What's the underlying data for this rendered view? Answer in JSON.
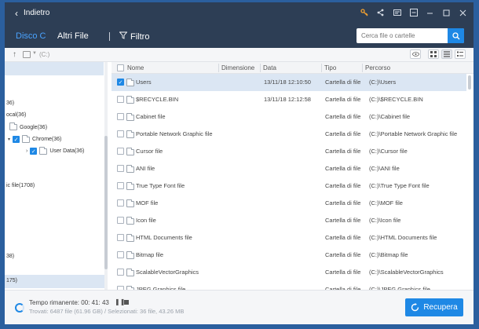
{
  "titlebar": {
    "back_label": "Indietro"
  },
  "nav": {
    "tabs": [
      {
        "label": "Disco C",
        "active": true
      },
      {
        "label": "Altri File",
        "active": false
      }
    ],
    "filter_label": "Filtro",
    "search_placeholder": "Cerca file o cartelle"
  },
  "pathbar": {
    "path": "(C:)"
  },
  "tree": {
    "items": [
      {
        "label": "36)"
      },
      {
        "label": "ocal(36)"
      },
      {
        "label": "Google(36)"
      },
      {
        "label": "Chrome(36)"
      },
      {
        "label": "User Data(36)"
      },
      {
        "label": "ic file(1708)"
      },
      {
        "label": "38)"
      },
      {
        "label": "175)"
      }
    ]
  },
  "list": {
    "columns": [
      "Nome",
      "Dimensione",
      "Data",
      "Tipo",
      "Percorso"
    ],
    "rows": [
      {
        "name": "Users",
        "date": "13/11/18 12:10:50",
        "type": "Cartella di file",
        "path": "(C:)\\Users"
      },
      {
        "name": "$RECYCLE.BIN",
        "date": "13/11/18 12:12:58",
        "type": "Cartella di file",
        "path": "(C:)\\$RECYCLE.BIN"
      },
      {
        "name": "Cabinet file",
        "date": "",
        "type": "Cartella di file",
        "path": "(C:)\\Cabinet file"
      },
      {
        "name": "Portable Network Graphic file",
        "date": "",
        "type": "Cartella di file",
        "path": "(C:)\\Portable Network Graphic file"
      },
      {
        "name": "Cursor file",
        "date": "",
        "type": "Cartella di file",
        "path": "(C:)\\Cursor file"
      },
      {
        "name": "ANI file",
        "date": "",
        "type": "Cartella di file",
        "path": "(C:)\\ANI file"
      },
      {
        "name": "True Type Font file",
        "date": "",
        "type": "Cartella di file",
        "path": "(C:)\\True Type Font file"
      },
      {
        "name": "MOF file",
        "date": "",
        "type": "Cartella di file",
        "path": "(C:)\\MOF file"
      },
      {
        "name": "Icon file",
        "date": "",
        "type": "Cartella di file",
        "path": "(C:)\\Icon file"
      },
      {
        "name": "HTML Documents file",
        "date": "",
        "type": "Cartella di file",
        "path": "(C:)\\HTML Documents file"
      },
      {
        "name": "Bitmap file",
        "date": "",
        "type": "Cartella di file",
        "path": "(C:)\\Bitmap file"
      },
      {
        "name": "ScalableVectorGraphics",
        "date": "",
        "type": "Cartella di file",
        "path": "(C:)\\ScalableVectorGraphics"
      },
      {
        "name": "JPEG Graphics file",
        "date": "",
        "type": "Cartella di file",
        "path": "(C:)\\JPEG Graphics file"
      }
    ]
  },
  "footer": {
    "time_remaining": "Tempo rimanente: 00: 41: 43",
    "stats": "Trovati: 6487 file (61.96 GB) / Selezionati: 36 file, 43.26 MB",
    "recover_label": "Recupera"
  },
  "colors": {
    "titlebar_bg": "#2d3e55",
    "accent": "#1e88e5",
    "active_tab": "#4aa3ff",
    "selection": "#dbe6f3"
  }
}
